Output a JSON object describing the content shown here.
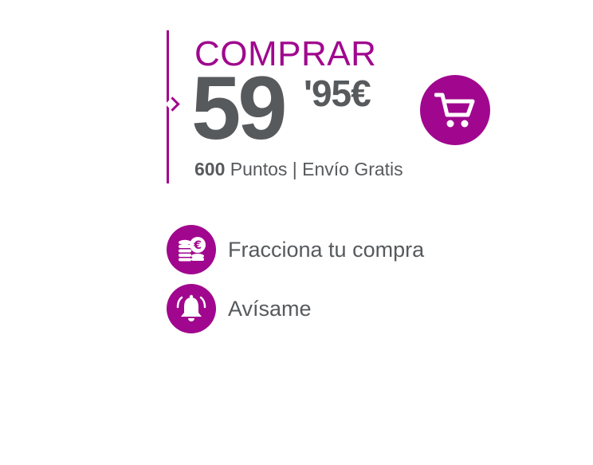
{
  "purchase": {
    "label": "COMPRAR",
    "price_integer": "59",
    "price_decimal": "'95€",
    "points_value": "600",
    "points_rest": " Puntos | Envío Gratis",
    "cart_icon": "shopping-cart-icon"
  },
  "actions": [
    {
      "label": "Fracciona tu compra",
      "icon": "coins-euro-icon"
    },
    {
      "label": "Avísame",
      "icon": "bell-icon"
    }
  ],
  "colors": {
    "accent": "#a0078e",
    "text": "#575a5d",
    "background": "#ffffff"
  }
}
